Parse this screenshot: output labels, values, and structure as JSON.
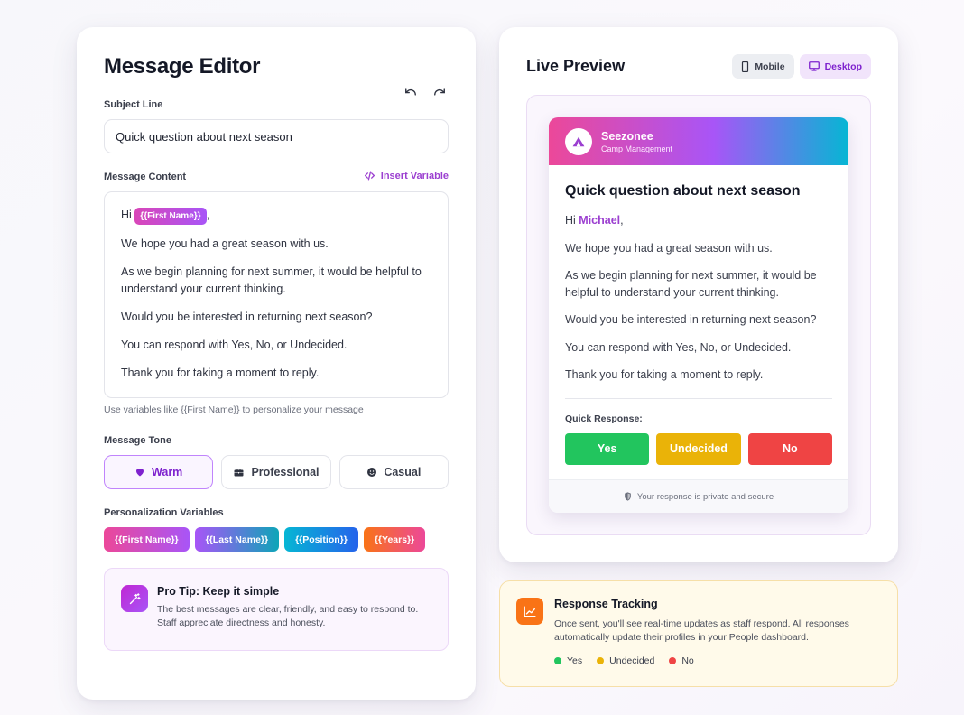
{
  "editor": {
    "title": "Message Editor",
    "subject_label": "Subject Line",
    "subject_value": "Quick question about next season",
    "content_label": "Message Content",
    "insert_variable": "Insert Variable",
    "content": {
      "greeting_prefix": "Hi",
      "greeting_var": "{{First Name}}",
      "greeting_suffix": ",",
      "lines": [
        "We hope you had a great season with us.",
        "As we begin planning for next summer, it would be helpful to understand your current thinking.",
        "Would you be interested in returning next season?",
        "You can respond with Yes, No, or Undecided.",
        "Thank you for taking a moment to reply."
      ]
    },
    "hint": "Use variables like {{First Name}} to personalize your message",
    "tone_label": "Message Tone",
    "tones": [
      {
        "label": "Warm",
        "icon": "heart-icon",
        "active": true
      },
      {
        "label": "Professional",
        "icon": "briefcase-icon",
        "active": false
      },
      {
        "label": "Casual",
        "icon": "smile-icon",
        "active": false
      }
    ],
    "variables_label": "Personalization Variables",
    "variables": [
      {
        "label": "{{First Name}}",
        "color_from": "#ec4899",
        "color_to": "#a855f7"
      },
      {
        "label": "{{Last Name}}",
        "color_from": "#a855f7",
        "color_to": "#0ea5b8"
      },
      {
        "label": "{{Position}}",
        "color_from": "#06b6d4",
        "color_to": "#2563eb"
      },
      {
        "label": "{{Years}}",
        "color_from": "#f97316",
        "color_to": "#ec4899"
      }
    ],
    "tip": {
      "title": "Pro Tip: Keep it simple",
      "text": "The best messages are clear, friendly, and easy to respond to. Staff appreciate directness and honesty."
    }
  },
  "preview": {
    "title": "Live Preview",
    "devices": [
      {
        "label": "Mobile",
        "icon": "phone-icon",
        "active": false
      },
      {
        "label": "Desktop",
        "icon": "monitor-icon",
        "active": true
      }
    ],
    "email": {
      "brand": "Seezonee",
      "brand_sub": "Camp Management",
      "subject": "Quick question about next season",
      "greeting_prefix": "Hi",
      "greeting_name": "Michael",
      "greeting_suffix": ",",
      "lines": [
        "We hope you had a great season with us.",
        "As we begin planning for next summer, it would be helpful to understand your current thinking.",
        "Would you be interested in returning next season?",
        "You can respond with Yes, No, or Undecided.",
        "Thank you for taking a moment to reply."
      ],
      "quick_response_label": "Quick Response:",
      "responses": [
        {
          "label": "Yes",
          "color": "#22c55e"
        },
        {
          "label": "Undecided",
          "color": "#eab308"
        },
        {
          "label": "No",
          "color": "#ef4444"
        }
      ],
      "footer": "Your response is private and secure"
    }
  },
  "tracking": {
    "title": "Response Tracking",
    "text": "Once sent, you'll see real-time updates as staff respond. All responses automatically update their profiles in your People dashboard.",
    "legend": [
      {
        "label": "Yes",
        "color": "#22c55e"
      },
      {
        "label": "Undecided",
        "color": "#eab308"
      },
      {
        "label": "No",
        "color": "#ef4444"
      }
    ]
  }
}
